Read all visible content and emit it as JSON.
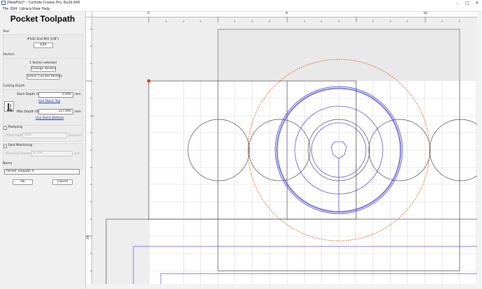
{
  "window": {
    "title": "[NewFile]* - Carbide Create Pro, Build 845"
  },
  "menu": {
    "items": [
      "File",
      "Edit",
      "Library",
      "View",
      "Help"
    ]
  },
  "panel": {
    "title": "Pocket Toolpath",
    "tool": {
      "section": "Tool",
      "name": "#102 End Mill (1/8\")",
      "edit_label": "Edit"
    },
    "vectors": {
      "section": "Vectors",
      "status": "1 Vector selected",
      "change_label": "Change Vectors",
      "select_current_label": "Select Current Vectors"
    },
    "cutting_depth": {
      "section": "Cutting Depth",
      "start_label": "Start Depth (S)",
      "start_value": "0.000",
      "start_unit": "mm",
      "use_stock_top": "Use Stock Top",
      "max_label": "Max Depth (D)",
      "max_value": "127.000",
      "max_unit": "mm",
      "use_stock_bottom": "Use Stock Bottom"
    },
    "ramping": {
      "label": "Ramping",
      "entry_angle_label": "Entry Angle",
      "entry_angle_value": "20.0",
      "entry_angle_unit": "Degrees"
    },
    "rest_machining": {
      "label": "Rest Machining",
      "prev_diameter_label": "Previous Diameter",
      "prev_diameter_value": "6.350",
      "prev_diameter_unit": "mm"
    },
    "name": {
      "section": "Name",
      "value": "Pocket Toolpath 4"
    },
    "ok_label": "Ok",
    "cancel_label": "Cancel"
  },
  "canvas": {
    "ruler_top_labels": [
      "0",
      "8",
      "16"
    ],
    "ruler_left_labels": [
      "16"
    ],
    "colors": {
      "grid": "#d6d6d6",
      "vector": "#4a4a4a",
      "toolpath": "#5a55d8",
      "selection": "#e2631f",
      "background": "#ffffff"
    }
  }
}
